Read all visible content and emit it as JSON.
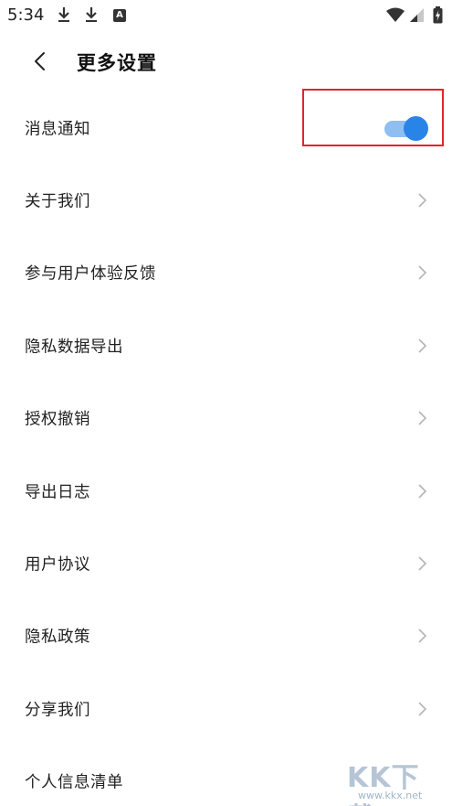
{
  "status_bar": {
    "time": "5:34",
    "a_badge": "A",
    "icons": [
      "download-icon",
      "download-icon",
      "a-badge-icon",
      "wifi-icon",
      "signal-icon",
      "battery-charging-icon"
    ]
  },
  "header": {
    "title": "更多设置",
    "back_icon": "chevron-left-icon"
  },
  "settings": {
    "notification_label": "消息通知",
    "notification_enabled": true,
    "items": [
      {
        "label": "关于我们"
      },
      {
        "label": "参与用户体验反馈"
      },
      {
        "label": "隐私数据导出"
      },
      {
        "label": "授权撤销"
      },
      {
        "label": "导出日志"
      },
      {
        "label": "用户协议"
      },
      {
        "label": "隐私政策"
      },
      {
        "label": "分享我们"
      },
      {
        "label": "个人信息清单"
      }
    ]
  },
  "watermark": {
    "text": "KK下载",
    "url": "www.kkx.net"
  },
  "colors": {
    "toggle_knob": "#2a84e8",
    "toggle_track": "#8fbef0",
    "highlight": "#e0262b"
  }
}
